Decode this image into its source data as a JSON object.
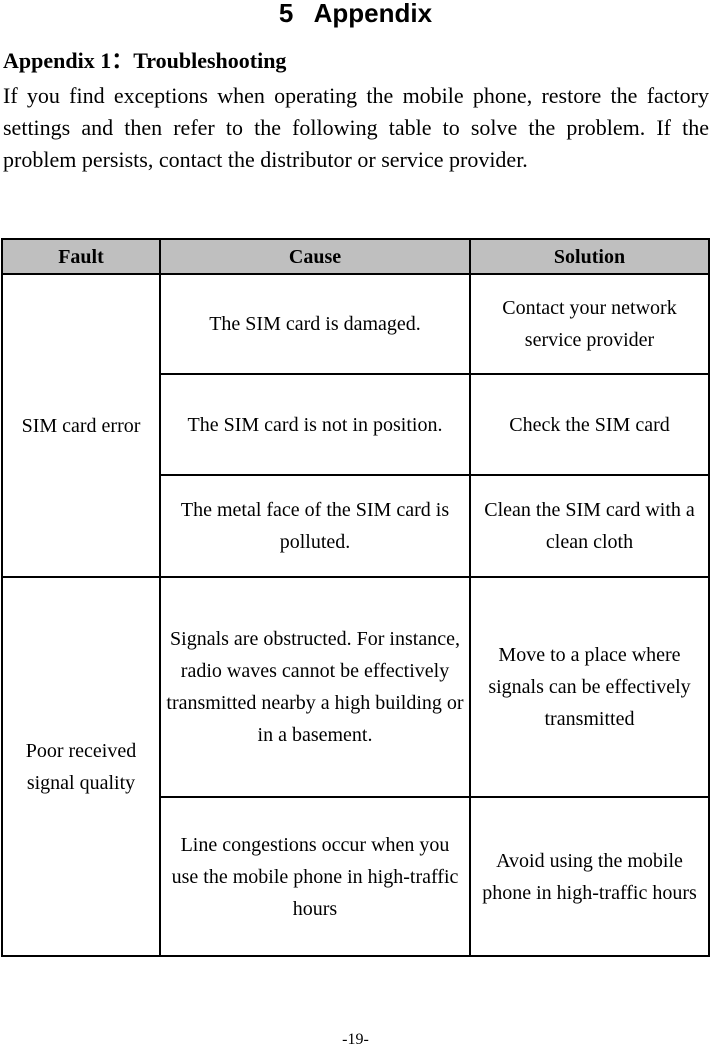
{
  "page": {
    "chapter_heading": "5   Appendix",
    "section_heading": "Appendix 1：Troubleshooting",
    "intro_paragraph": "If you find exceptions when operating the mobile phone, restore the factory settings and then refer to the following table to solve the problem. If the problem persists, contact the distributor or service provider.",
    "page_number": "-19-"
  },
  "table": {
    "headers": {
      "fault": "Fault",
      "cause": "Cause",
      "solution": "Solution"
    },
    "groups": [
      {
        "fault": "SIM card error",
        "rows": [
          {
            "cause": "The SIM card is damaged.",
            "solution": "Contact your network service provider"
          },
          {
            "cause": "The SIM card is not in position.",
            "solution": "Check the SIM card"
          },
          {
            "cause": "The metal face of the SIM card is polluted.",
            "solution": "Clean the SIM card with a clean cloth"
          }
        ]
      },
      {
        "fault": "Poor received signal quality",
        "rows": [
          {
            "cause": "Signals are obstructed. For instance, radio waves cannot be effectively transmitted nearby a high building or in a basement.",
            "solution": "Move to a place where signals can be effectively transmitted"
          },
          {
            "cause": "Line congestions occur when you use the mobile phone in high-traffic hours",
            "solution": "Avoid using the mobile phone in high-traffic hours"
          }
        ]
      }
    ]
  },
  "colors": {
    "header_background": "#bfbfbf",
    "border": "#000000",
    "text": "#000000"
  }
}
